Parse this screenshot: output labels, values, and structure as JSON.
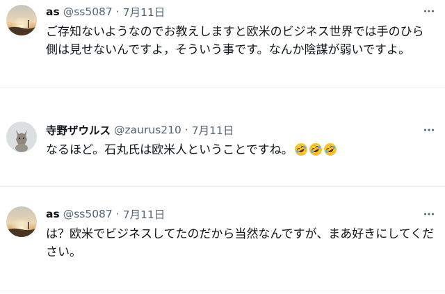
{
  "tweets": [
    {
      "name": "as",
      "handle": "@ss5087",
      "separator": "·",
      "date": "7月11日",
      "text": "ご存知ないようなのでお教えしますと欧米のビジネス世界では手のひら側は見せないんですよ，そういう事です。なんか陰謀が弱いですよ。"
    },
    {
      "name": "寺野ザウルス",
      "handle": "@zaurus210",
      "separator": "·",
      "date": "7月11日",
      "text": "なるほど。石丸氏は欧米人ということですね。",
      "emoji": [
        "rolling-on-floor-laughing",
        "rolling-on-floor-laughing",
        "rolling-on-floor-laughing"
      ]
    },
    {
      "name": "as",
      "handle": "@ss5087",
      "separator": "·",
      "date": "7月11日",
      "text": "は？欧米でビジネスしてたのだから当然なんですが、まあ好きにしてください。"
    }
  ],
  "icons": {
    "more": "more-horizontal-icon",
    "emoji": "rolling-on-floor-laughing"
  },
  "colors": {
    "text": "#0f1419",
    "secondary": "#536471",
    "divider": "#eff3f4",
    "background": "#ffffff"
  }
}
